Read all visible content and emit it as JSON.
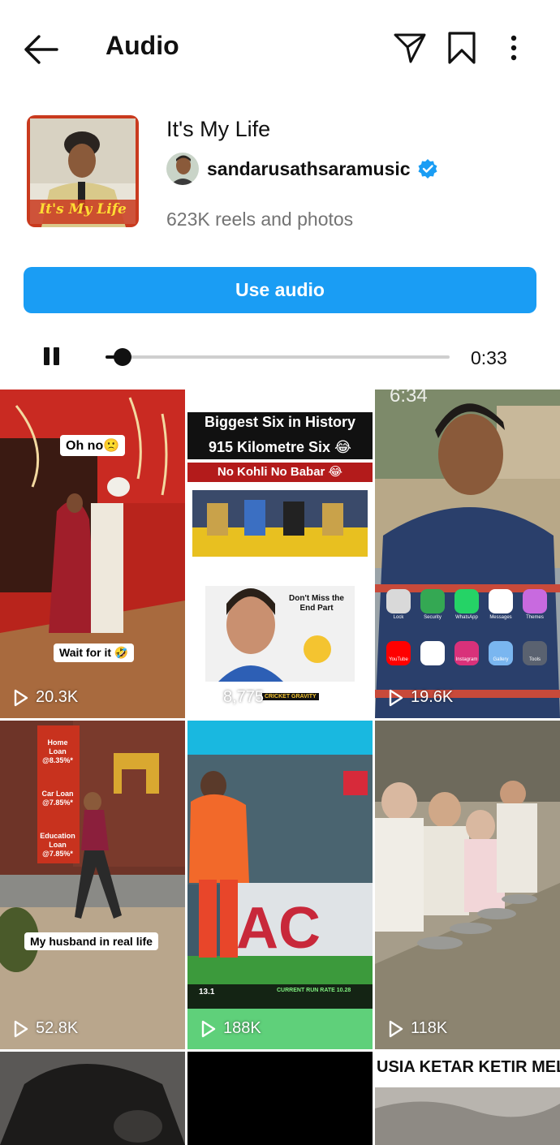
{
  "header": {
    "title": "Audio",
    "icons": [
      "back-arrow-icon",
      "send-icon",
      "bookmark-icon",
      "more-options-icon"
    ]
  },
  "audio": {
    "cover_text": "It's My Life",
    "track_title": "It's My Life",
    "artist": "sandarusathsaramusic",
    "verified": true,
    "count": "623K reels and photos",
    "use_button": "Use audio",
    "elapsed": "0:33",
    "progress_fraction": 0.05
  },
  "colors": {
    "accent": "#1a9df4",
    "verified": "#1a9df4",
    "track_bg": "#cfcfcf"
  },
  "reels": [
    {
      "views": "20.3K",
      "caption_top": "Oh no🙁",
      "caption_bottom": "Wait for it 🤣"
    },
    {
      "views": "8,775",
      "headline_1": "Biggest Six in History",
      "headline_2": "915 Kilometre Six 😂",
      "headline_3": "No Kohli No Babar 😂",
      "sticker": "Don't Miss the End Part",
      "brand": "CRICKET GRAVITY"
    },
    {
      "views": "19.6K",
      "status_time": "6:34",
      "apps": [
        "Lock",
        "Security",
        "WhatsApp",
        "Messages",
        "Themes",
        "YouTube",
        "Play Store",
        "Instagram",
        "Gallery",
        "Tools"
      ]
    },
    {
      "views": "52.8K",
      "caption": "My husband in real life",
      "banner_lines": [
        "Home Loan @8.35%*",
        "Car Loan @7.85%*",
        "Education Loan @7.85%*"
      ]
    },
    {
      "views": "188K",
      "ticker_left": "13.1",
      "ticker_right": "CURRENT RUN RATE 10.28"
    },
    {
      "views": "118K"
    },
    {
      "views": ""
    },
    {
      "views": ""
    },
    {
      "views": "",
      "headline": "USIA KETAR KETIR MELIA"
    }
  ]
}
